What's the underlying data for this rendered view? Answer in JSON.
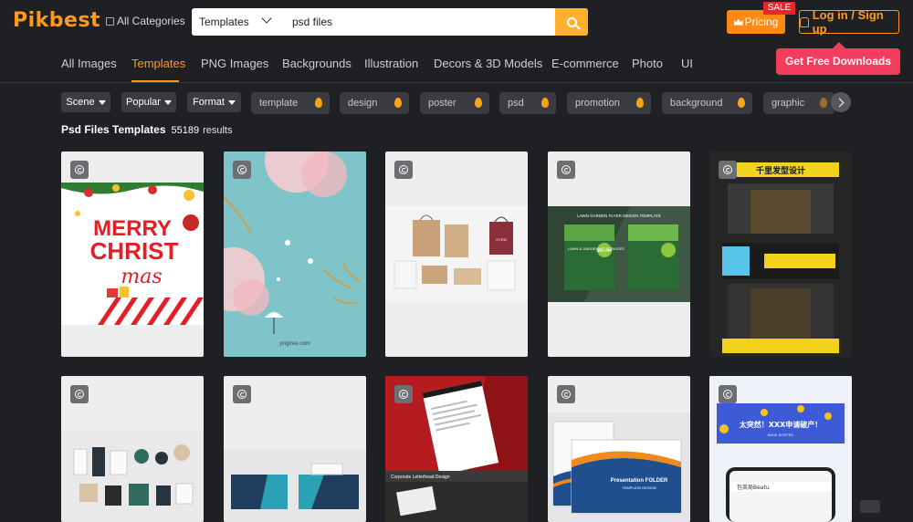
{
  "header": {
    "logo": "Pikbest",
    "all_categories": "All Categories",
    "search_type": "Templates",
    "search_value": "psd files",
    "pricing": "Pricing",
    "sale_badge": "SALE",
    "login": "Log in / Sign up"
  },
  "nav": {
    "tabs": [
      "All Images",
      "Templates",
      "PNG Images",
      "Backgrounds",
      "Illustration",
      "Decors & 3D Models",
      "E-commerce",
      "Photo",
      "UI"
    ],
    "active": "Templates",
    "promo": "Get Free Downloads"
  },
  "filters": {
    "dropdowns": [
      "Scene",
      "Popular",
      "Format"
    ],
    "tags": [
      "template",
      "design",
      "poster",
      "psd",
      "promotion",
      "background",
      "graphic"
    ]
  },
  "results": {
    "title": "Psd Files Templates",
    "count": "55189",
    "suffix": "results"
  },
  "cards": {
    "xmas_line1": "MERRY",
    "xmas_line2": "CHRIST",
    "xmas_line3": "mas",
    "watercolor_footer": "pngtree.com",
    "bag_label": "OTEM",
    "flyer_heading": "LAWN GARDEN FLYER DESIGN TEMPLATE",
    "flyer_title": "LAWN & GARDENING SERVICES",
    "flyer_badge": "30% OFF",
    "shop_sign": "千里发型设计",
    "letterhead_caption": "Corporate Letterhead Design",
    "folder_title": "Presentation FOLDER",
    "folder_subtitle": "TEMPLATE DESIGN",
    "app_banner": "太突然！XXX申请破产！",
    "app_banner_sub": "BANK BORTEN",
    "app_url": "包英局Beatu"
  }
}
